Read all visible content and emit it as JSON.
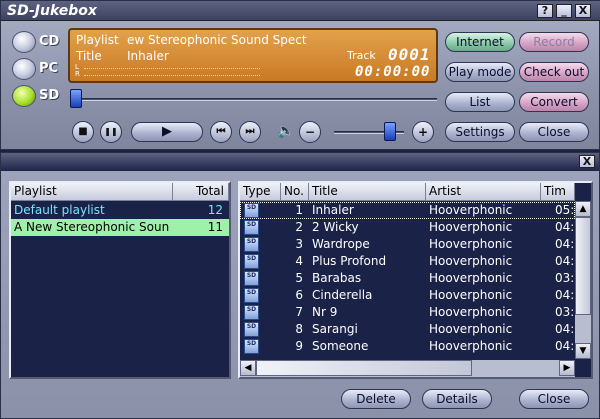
{
  "window": {
    "title": "SD-Jukebox",
    "help": "?",
    "minimize": "_",
    "close": "X"
  },
  "sources": [
    {
      "label": "CD",
      "selected": false
    },
    {
      "label": "PC",
      "selected": false
    },
    {
      "label": "SD",
      "selected": true
    }
  ],
  "display": {
    "playlist_label": "Playlist",
    "playlist_value": "ew Stereophonic Sound Spectacu",
    "title_label": "Title",
    "title_value": "Inhaler",
    "track_label": "Track",
    "track_number": "0001",
    "time": "00:00:00",
    "level_label": "L R"
  },
  "right_buttons": {
    "internet": "Internet",
    "record": "Record",
    "play_mode": "Play mode",
    "check_out": "Check out",
    "list": "List",
    "convert": "Convert",
    "settings": "Settings",
    "close": "Close"
  },
  "transport": {
    "stop": "■",
    "pause": "❚❚",
    "play": "▶",
    "prev": "⏮",
    "next": "⏭",
    "speaker": "🔈",
    "vol_down": "−",
    "vol_up": "+"
  },
  "playlist_window": {
    "close": "X"
  },
  "playlists": {
    "headers": {
      "name": "Playlist",
      "total": "Total"
    },
    "rows": [
      {
        "name": "Default playlist",
        "total": "12"
      },
      {
        "name": "A New Stereophonic Sound S",
        "total": "11"
      }
    ]
  },
  "tracks": {
    "headers": {
      "type": "Type",
      "no": "No.",
      "title": "Title",
      "artist": "Artist",
      "time": "Tim"
    },
    "type_icon_text": "SD",
    "rows": [
      {
        "no": "1",
        "title": "Inhaler",
        "artist": "Hooverphonic",
        "time": "05:"
      },
      {
        "no": "2",
        "title": "2 Wicky",
        "artist": "Hooverphonic",
        "time": "04:"
      },
      {
        "no": "3",
        "title": "Wardrope",
        "artist": "Hooverphonic",
        "time": "04:"
      },
      {
        "no": "4",
        "title": "Plus Profond",
        "artist": "Hooverphonic",
        "time": "04:"
      },
      {
        "no": "5",
        "title": "Barabas",
        "artist": "Hooverphonic",
        "time": "03:"
      },
      {
        "no": "6",
        "title": "Cinderella",
        "artist": "Hooverphonic",
        "time": "04:"
      },
      {
        "no": "7",
        "title": "Nr 9",
        "artist": "Hooverphonic",
        "time": "03:"
      },
      {
        "no": "8",
        "title": "Sarangi",
        "artist": "Hooverphonic",
        "time": "04:"
      },
      {
        "no": "9",
        "title": "Someone",
        "artist": "Hooverphonic",
        "time": "04:"
      }
    ]
  },
  "bottom_buttons": {
    "delete": "Delete",
    "details": "Details",
    "close": "Close"
  }
}
